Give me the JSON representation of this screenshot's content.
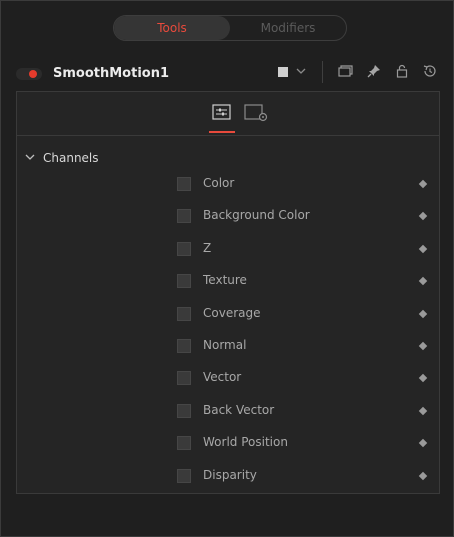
{
  "tabs": [
    {
      "label": "Tools",
      "active": true
    },
    {
      "label": "Modifiers",
      "active": false
    }
  ],
  "node": {
    "name": "SmoothMotion1",
    "enabled": true
  },
  "colors": {
    "accent": "#e84a3c",
    "enabled_dot": "#e53b2c",
    "background": "#1f1f1f",
    "panel": "#252525"
  },
  "header_icons": [
    "color-swatch-icon",
    "chevron-down-icon",
    "view-icon",
    "pin-icon",
    "lock-icon",
    "reset-icon"
  ],
  "panel_tabs": [
    {
      "icon": "controls-icon",
      "active": true
    },
    {
      "icon": "settings-icon",
      "active": false
    }
  ],
  "section": {
    "title": "Channels",
    "expanded": true
  },
  "channels": [
    {
      "label": "Color",
      "checked": false
    },
    {
      "label": "Background Color",
      "checked": false
    },
    {
      "label": "Z",
      "checked": false
    },
    {
      "label": "Texture",
      "checked": false
    },
    {
      "label": "Coverage",
      "checked": false
    },
    {
      "label": "Normal",
      "checked": false
    },
    {
      "label": "Vector",
      "checked": false
    },
    {
      "label": "Back Vector",
      "checked": false
    },
    {
      "label": "World Position",
      "checked": false
    },
    {
      "label": "Disparity",
      "checked": false
    }
  ]
}
